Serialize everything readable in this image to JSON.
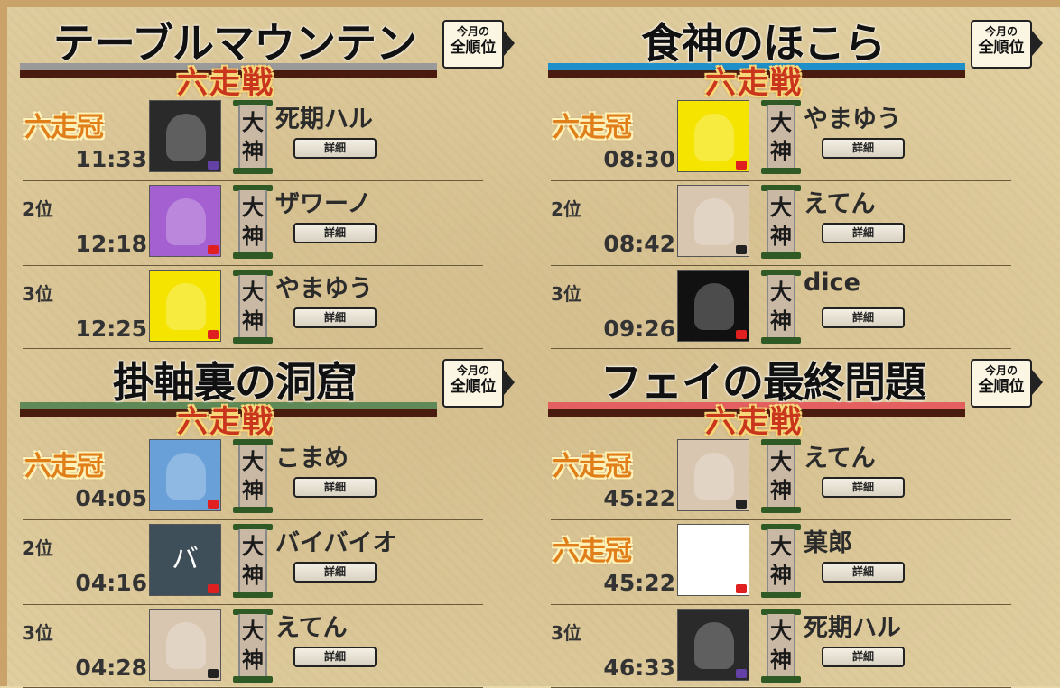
{
  "panels": [
    {
      "title": "テーブルマウンテン",
      "subtitle": "六走戦",
      "band_color": "#9a9a9a",
      "rank_button": {
        "line1": "今月の",
        "line2": "全順位"
      },
      "rows": [
        {
          "place": "",
          "crown": "六走冠",
          "time": "11:33",
          "name": "死期ハル",
          "rank_label": "大神",
          "detail": "詳細",
          "avatar_icon": "dark-masked-character",
          "platform_icon": "twitch-icon",
          "avatar_bg": "#2a2a2a"
        },
        {
          "place": "2位",
          "crown": "",
          "time": "12:18",
          "name": "ザワーノ",
          "rank_label": "大神",
          "detail": "詳細",
          "avatar_icon": "glasses-man-cartoon",
          "platform_icon": "youtube-icon",
          "avatar_bg": "#a45fd0"
        },
        {
          "place": "3位",
          "crown": "",
          "time": "12:25",
          "name": "やまゆう",
          "rank_label": "大神",
          "detail": "詳細",
          "avatar_icon": "green-dinosaur",
          "platform_icon": "youtube-icon",
          "avatar_bg": "#f5e400"
        }
      ]
    },
    {
      "title": "食神のほこら",
      "subtitle": "六走戦",
      "band_color": "#1e8fc8",
      "rank_button": {
        "line1": "今月の",
        "line2": "全順位"
      },
      "rows": [
        {
          "place": "",
          "crown": "六走冠",
          "time": "08:30",
          "name": "やまゆう",
          "rank_label": "大神",
          "detail": "詳細",
          "avatar_icon": "green-dinosaur",
          "platform_icon": "youtube-icon",
          "avatar_bg": "#f5e400"
        },
        {
          "place": "2位",
          "crown": "",
          "time": "08:42",
          "name": "えてん",
          "rank_label": "大神",
          "detail": "詳細",
          "avatar_icon": "anime-girl-brown-hair",
          "platform_icon": "niconico-icon",
          "avatar_bg": "#d9c6b0"
        },
        {
          "place": "3位",
          "crown": "",
          "time": "09:26",
          "name": "dice",
          "rank_label": "大神",
          "detail": "詳細",
          "avatar_icon": "knight-with-dice",
          "platform_icon": "youtube-icon",
          "avatar_bg": "#111111"
        }
      ]
    },
    {
      "title": "掛軸裏の洞窟",
      "subtitle": "六走戦",
      "band_color": "#5f8a58",
      "rank_button": {
        "line1": "今月の",
        "line2": "全順位"
      },
      "rows": [
        {
          "place": "",
          "crown": "六走冠",
          "time": "04:05",
          "name": "こまめ",
          "rank_label": "大神",
          "detail": "詳細",
          "avatar_icon": "girl-with-horse",
          "platform_icon": "youtube-icon",
          "avatar_bg": "#6aa0d8"
        },
        {
          "place": "2位",
          "crown": "",
          "time": "04:16",
          "name": "バイバイオ",
          "rank_label": "大神",
          "detail": "詳細",
          "avatar_icon": "letter-ba",
          "avatar_text": "バ",
          "platform_icon": "youtube-icon",
          "avatar_bg": "#3e4f5a"
        },
        {
          "place": "3位",
          "crown": "",
          "time": "04:28",
          "name": "えてん",
          "rank_label": "大神",
          "detail": "詳細",
          "avatar_icon": "anime-girl-brown-hair",
          "platform_icon": "niconico-icon",
          "avatar_bg": "#d9c6b0"
        }
      ]
    },
    {
      "title": "フェイの最終問題",
      "subtitle": "六走戦",
      "band_color": "#e46060",
      "rank_button": {
        "line1": "今月の",
        "line2": "全順位"
      },
      "rows": [
        {
          "place": "",
          "crown": "六走冠",
          "time": "45:22",
          "name": "えてん",
          "rank_label": "大神",
          "detail": "詳細",
          "avatar_icon": "anime-girl-brown-hair",
          "platform_icon": "niconico-icon",
          "avatar_bg": "#d9c6b0"
        },
        {
          "place": "",
          "crown": "六走冠",
          "time": "45:22",
          "name": "菓郎",
          "rank_label": "大神",
          "detail": "詳細",
          "avatar_icon": "white-cat-with-cap",
          "platform_icon": "youtube-icon",
          "avatar_bg": "#ffffff"
        },
        {
          "place": "3位",
          "crown": "",
          "time": "46:33",
          "name": "死期ハル",
          "rank_label": "大神",
          "detail": "詳細",
          "avatar_icon": "dark-masked-character",
          "platform_icon": "twitch-icon",
          "avatar_bg": "#2a2a2a"
        }
      ]
    }
  ]
}
